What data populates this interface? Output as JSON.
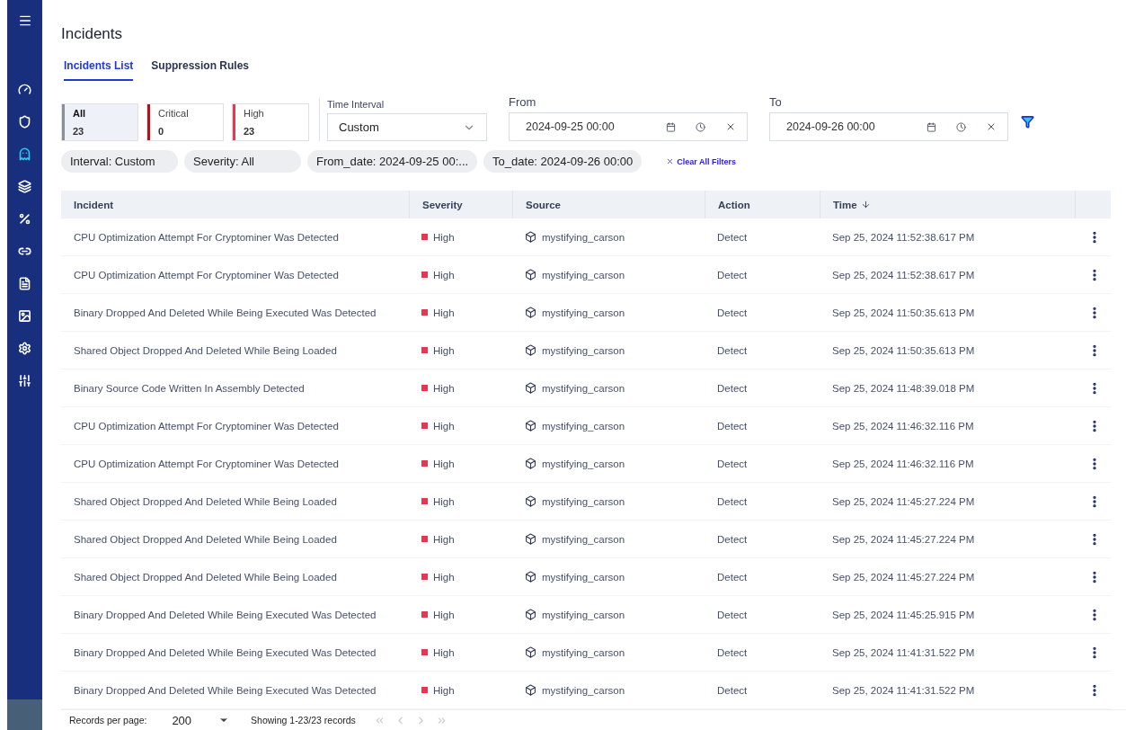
{
  "sidebar": {
    "items": [
      {
        "kind": "gauge",
        "selected": false
      },
      {
        "kind": "shield",
        "selected": false
      },
      {
        "kind": "ghost",
        "selected": true
      },
      {
        "kind": "layers",
        "selected": false
      },
      {
        "kind": "percent",
        "selected": false
      },
      {
        "kind": "link",
        "selected": false
      },
      {
        "kind": "list",
        "selected": false
      },
      {
        "kind": "image",
        "selected": false
      },
      {
        "kind": "gear",
        "selected": false
      },
      {
        "kind": "sliders",
        "selected": false
      }
    ]
  },
  "title": "Incidents",
  "tabs": [
    {
      "label": "Incidents List",
      "selected": true
    },
    {
      "label": "Suppression Rules",
      "selected": false
    }
  ],
  "severity_cards": [
    {
      "label": "All",
      "count": "23",
      "selected": true,
      "color": "#8a8f98"
    },
    {
      "label": "Critical",
      "count": "0",
      "selected": false,
      "color": "#b3141c"
    },
    {
      "label": "High",
      "count": "23",
      "selected": false,
      "color": "#e5384f"
    }
  ],
  "time_interval": {
    "label": "Time Interval",
    "value": "Custom"
  },
  "from": {
    "label": "From",
    "value": "2024-09-25 00:00"
  },
  "to": {
    "label": "To",
    "value": "2024-09-26 00:00"
  },
  "chips": [
    "Interval: Custom",
    "Severity: All",
    "From_date: 2024-09-25 00:...",
    "To_date: 2024-09-26 00:00"
  ],
  "clear_filters": "Clear All Filters",
  "table": {
    "columns": [
      "Incident",
      "Severity",
      "Source",
      "Action",
      "Time"
    ],
    "rows": [
      {
        "incident": "CPU Optimization Attempt For Cryptominer Was Detected",
        "severity": "High",
        "source": "mystifying_carson",
        "action": "Detect",
        "time": "Sep 25, 2024 11:52:38.617 PM"
      },
      {
        "incident": "CPU Optimization Attempt For Cryptominer Was Detected",
        "severity": "High",
        "source": "mystifying_carson",
        "action": "Detect",
        "time": "Sep 25, 2024 11:52:38.617 PM"
      },
      {
        "incident": "Binary Dropped And Deleted While Being Executed Was Detected",
        "severity": "High",
        "source": "mystifying_carson",
        "action": "Detect",
        "time": "Sep 25, 2024 11:50:35.613 PM"
      },
      {
        "incident": "Shared Object Dropped And Deleted While Being Loaded",
        "severity": "High",
        "source": "mystifying_carson",
        "action": "Detect",
        "time": "Sep 25, 2024 11:50:35.613 PM"
      },
      {
        "incident": "Binary Source Code Written In Assembly Detected",
        "severity": "High",
        "source": "mystifying_carson",
        "action": "Detect",
        "time": "Sep 25, 2024 11:48:39.018 PM"
      },
      {
        "incident": "CPU Optimization Attempt For Cryptominer Was Detected",
        "severity": "High",
        "source": "mystifying_carson",
        "action": "Detect",
        "time": "Sep 25, 2024 11:46:32.116 PM"
      },
      {
        "incident": "CPU Optimization Attempt For Cryptominer Was Detected",
        "severity": "High",
        "source": "mystifying_carson",
        "action": "Detect",
        "time": "Sep 25, 2024 11:46:32.116 PM"
      },
      {
        "incident": "Shared Object Dropped And Deleted While Being Loaded",
        "severity": "High",
        "source": "mystifying_carson",
        "action": "Detect",
        "time": "Sep 25, 2024 11:45:27.224 PM"
      },
      {
        "incident": "Shared Object Dropped And Deleted While Being Loaded",
        "severity": "High",
        "source": "mystifying_carson",
        "action": "Detect",
        "time": "Sep 25, 2024 11:45:27.224 PM"
      },
      {
        "incident": "Shared Object Dropped And Deleted While Being Loaded",
        "severity": "High",
        "source": "mystifying_carson",
        "action": "Detect",
        "time": "Sep 25, 2024 11:45:27.224 PM"
      },
      {
        "incident": "Binary Dropped And Deleted While Being Executed Was Detected",
        "severity": "High",
        "source": "mystifying_carson",
        "action": "Detect",
        "time": "Sep 25, 2024 11:45:25.915 PM"
      },
      {
        "incident": "Binary Dropped And Deleted While Being Executed Was Detected",
        "severity": "High",
        "source": "mystifying_carson",
        "action": "Detect",
        "time": "Sep 25, 2024 11:41:31.522 PM"
      },
      {
        "incident": "Binary Dropped And Deleted While Being Executed Was Detected",
        "severity": "High",
        "source": "mystifying_carson",
        "action": "Detect",
        "time": "Sep 25, 2024 11:41:31.522 PM"
      }
    ]
  },
  "footer": {
    "label": "Records per page:",
    "page_size": "200",
    "summary": "Showing 1-23/23 records"
  }
}
